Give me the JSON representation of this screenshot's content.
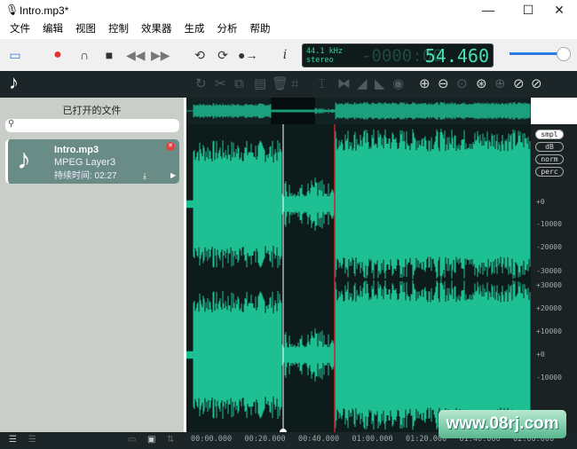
{
  "window": {
    "title": "Intro.mp3*",
    "minimize": "—",
    "maximize": "☐",
    "close": "✕"
  },
  "menu": [
    "文件",
    "编辑",
    "视图",
    "控制",
    "效果器",
    "生成",
    "分析",
    "帮助"
  ],
  "toolbar": {
    "info": "i"
  },
  "lcd": {
    "rate": "44.1 kHz",
    "channels": "stereo",
    "dim": "-0000:00",
    "time": "54.460"
  },
  "volume": {
    "level": 0.9
  },
  "colors": {
    "waveform": "#1fbf94",
    "playhead": "#ffffff",
    "marker": "#d02020",
    "background": "#0d1b1b"
  },
  "sidebar": {
    "title": "已打开的文件",
    "search_placeholder": "",
    "file": {
      "name": "Intro.mp3",
      "format": "MPEG Layer3",
      "duration": "持续时间: 02:27"
    }
  },
  "ruler": {
    "modes": [
      "smpl",
      "dB",
      "norm",
      "perc"
    ],
    "active_mode": "smpl",
    "labels": [
      "+0",
      "-10000",
      "-20000",
      "-30000",
      "+30000",
      "+20000",
      "+10000",
      "+0",
      "-10000"
    ]
  },
  "timeline": [
    "00:00.000",
    "00:20.000",
    "00:40.000",
    "01:00.000",
    "01:20.000",
    "01:40.000",
    "02:00.000"
  ],
  "watermark": "www.08rj.com"
}
